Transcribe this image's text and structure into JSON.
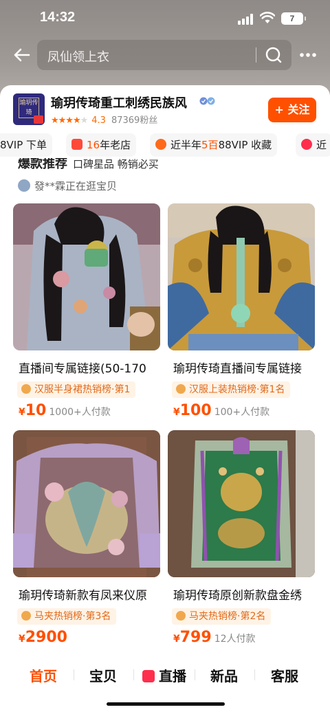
{
  "status_bar": {
    "time": "14:32",
    "battery": "7"
  },
  "search": {
    "query": "凤仙领上衣"
  },
  "shop": {
    "name": "瑜玥传琦重工刺绣民族风",
    "logo_text": "瑜玥传琦",
    "stars": "★★★★",
    "rating": "4.3",
    "fans": "87369粉丝",
    "follow_label": "+ 关注"
  },
  "tags": [
    {
      "text": "8VIP 下单"
    },
    {
      "pre": "",
      "hl": "16",
      "post": "年老店"
    },
    {
      "pre": "近半年",
      "hl": "5百",
      "post": "88VIP 收藏"
    },
    {
      "text": "近"
    }
  ],
  "section": {
    "title": "爆款推荐",
    "subtitle": "口碑星品 畅销必买"
  },
  "visitor": {
    "text": "發**霖正在逛宝贝"
  },
  "products": [
    {
      "title": "直播间专属链接(50-170",
      "rank": "汉服半身裙热销榜·第1",
      "price_symbol": "¥",
      "price": "10",
      "paid": "1000+人付款"
    },
    {
      "title": "瑜玥传琦直播间专属链接",
      "rank": "汉服上装热销榜·第1名",
      "price_symbol": "¥",
      "price": "100",
      "paid": "100+人付款"
    },
    {
      "title": "瑜玥传琦新款有凤来仪原",
      "rank": "马夹热销榜·第3名",
      "price_symbol": "¥",
      "price": "2900",
      "paid": ""
    },
    {
      "title": "瑜玥传琦原创新款盘金绣",
      "rank": "马夹热销榜·第2名",
      "price_symbol": "¥",
      "price": "799",
      "paid": "12人付款"
    }
  ],
  "tabbar": {
    "home": "首页",
    "items": "宝贝",
    "live": "直播",
    "new": "新品",
    "service": "客服"
  },
  "colors": {
    "accent": "#ff5000",
    "rank_bg": "#fff3e6"
  }
}
